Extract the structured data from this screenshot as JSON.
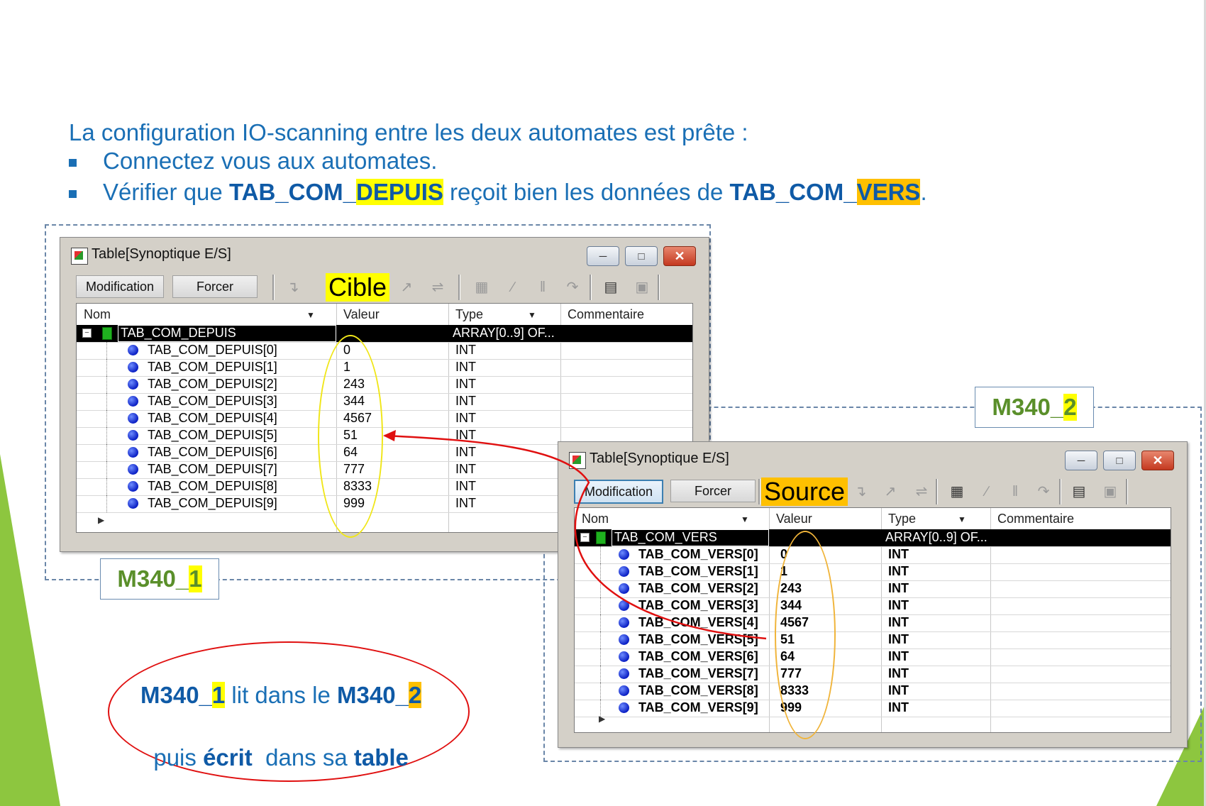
{
  "slide": {
    "intro": "La configuration IO-scanning entre les deux automates est prête :",
    "bullet1": "Connectez vous aux automates.",
    "bullet2_pre": "Vérifier que ",
    "bullet2_b1": "TAB_COM_",
    "bullet2_b1_hl": "DEPUIS",
    "bullet2_mid": " reçoit bien les données de ",
    "bullet2_b2": "TAB_COM_",
    "bullet2_b2_hl": "VERS",
    "bullet2_end": "."
  },
  "labels": {
    "m1_pre": "M340_",
    "m1_hl": "1",
    "m2_pre": "M340_",
    "m2_hl": "2"
  },
  "note": {
    "p1": "M340_",
    "p1_hl": "1",
    "p2": " lit dans le ",
    "p3": "M340_",
    "p3_hl": "2",
    "p4": "puis ",
    "p5": "écrit",
    "p6": "  dans sa ",
    "p7": "table"
  },
  "window_cible": {
    "title": "Table[Synoptique E/S]",
    "btn_modification": "Modification",
    "btn_forcer": "Forcer",
    "callout": "Cible",
    "col_nom": "Nom",
    "col_valeur": "Valeur",
    "col_type": "Type",
    "col_commentaire": "Commentaire",
    "parent_name": "TAB_COM_DEPUIS",
    "parent_type": "ARRAY[0..9] OF...",
    "rows": [
      {
        "name": "TAB_COM_DEPUIS[0]",
        "value": "0",
        "type": "INT"
      },
      {
        "name": "TAB_COM_DEPUIS[1]",
        "value": "1",
        "type": "INT"
      },
      {
        "name": "TAB_COM_DEPUIS[2]",
        "value": "243",
        "type": "INT"
      },
      {
        "name": "TAB_COM_DEPUIS[3]",
        "value": "344",
        "type": "INT"
      },
      {
        "name": "TAB_COM_DEPUIS[4]",
        "value": "4567",
        "type": "INT"
      },
      {
        "name": "TAB_COM_DEPUIS[5]",
        "value": "51",
        "type": "INT"
      },
      {
        "name": "TAB_COM_DEPUIS[6]",
        "value": "64",
        "type": "INT"
      },
      {
        "name": "TAB_COM_DEPUIS[7]",
        "value": "777",
        "type": "INT"
      },
      {
        "name": "TAB_COM_DEPUIS[8]",
        "value": "8333",
        "type": "INT"
      },
      {
        "name": "TAB_COM_DEPUIS[9]",
        "value": "999",
        "type": "INT"
      }
    ]
  },
  "window_source": {
    "title": "Table[Synoptique E/S]",
    "btn_modification": "Modification",
    "btn_forcer": "Forcer",
    "callout": "Source",
    "col_nom": "Nom",
    "col_valeur": "Valeur",
    "col_type": "Type",
    "col_commentaire": "Commentaire",
    "parent_name": "TAB_COM_VERS",
    "parent_type": "ARRAY[0..9] OF...",
    "rows": [
      {
        "name": "TAB_COM_VERS[0]",
        "value": "0",
        "type": "INT"
      },
      {
        "name": "TAB_COM_VERS[1]",
        "value": "1",
        "type": "INT"
      },
      {
        "name": "TAB_COM_VERS[2]",
        "value": "243",
        "type": "INT"
      },
      {
        "name": "TAB_COM_VERS[3]",
        "value": "344",
        "type": "INT"
      },
      {
        "name": "TAB_COM_VERS[4]",
        "value": "4567",
        "type": "INT"
      },
      {
        "name": "TAB_COM_VERS[5]",
        "value": "51",
        "type": "INT"
      },
      {
        "name": "TAB_COM_VERS[6]",
        "value": "64",
        "type": "INT"
      },
      {
        "name": "TAB_COM_VERS[7]",
        "value": "777",
        "type": "INT"
      },
      {
        "name": "TAB_COM_VERS[8]",
        "value": "8333",
        "type": "INT"
      },
      {
        "name": "TAB_COM_VERS[9]",
        "value": "999",
        "type": "INT"
      }
    ]
  },
  "colors": {
    "text_blue": "#1a6fb5",
    "label_green": "#5a8f2a",
    "highlight_yellow": "#ffff00",
    "highlight_orange": "#ffc000",
    "arrow_red": "#e01010"
  }
}
